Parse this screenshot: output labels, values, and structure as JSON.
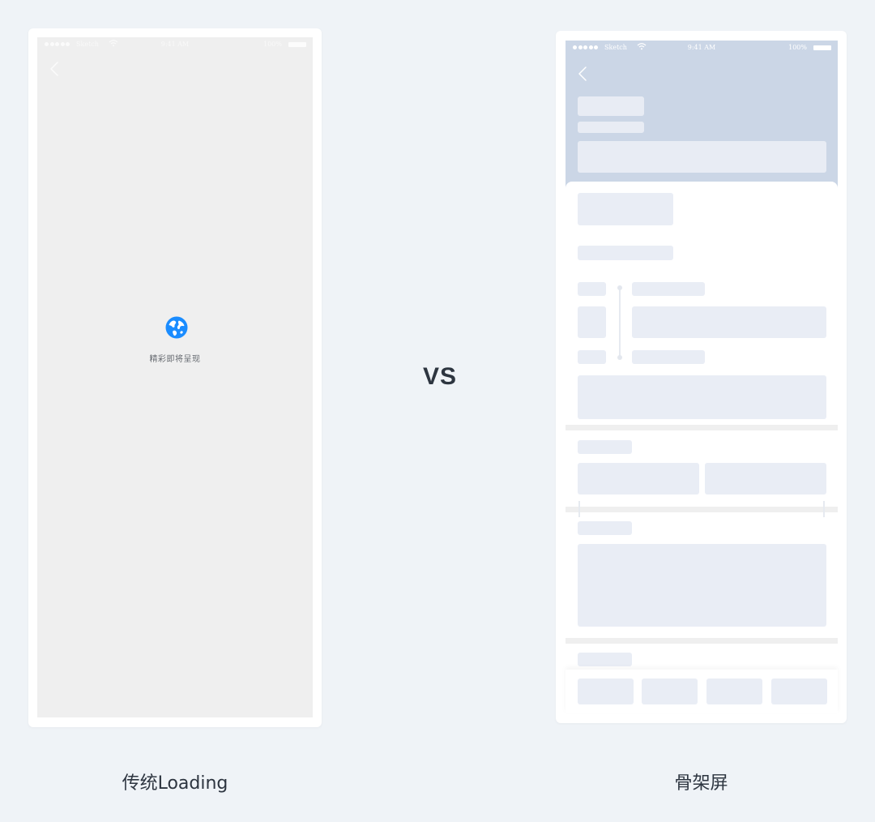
{
  "status_bar": {
    "carrier": "Sketch",
    "time": "9:41 AM",
    "battery": "100%"
  },
  "traditional": {
    "caption": "传统Loading",
    "loading_text": "精彩即将呈现",
    "loading_icon": "globe-icon",
    "accent_color": "#1a8cff"
  },
  "comparison": {
    "vs_label": "VS"
  },
  "skeleton": {
    "caption": "骨架屏",
    "header_color": "#cbd6e6",
    "placeholder_color": "#e9edf5"
  }
}
